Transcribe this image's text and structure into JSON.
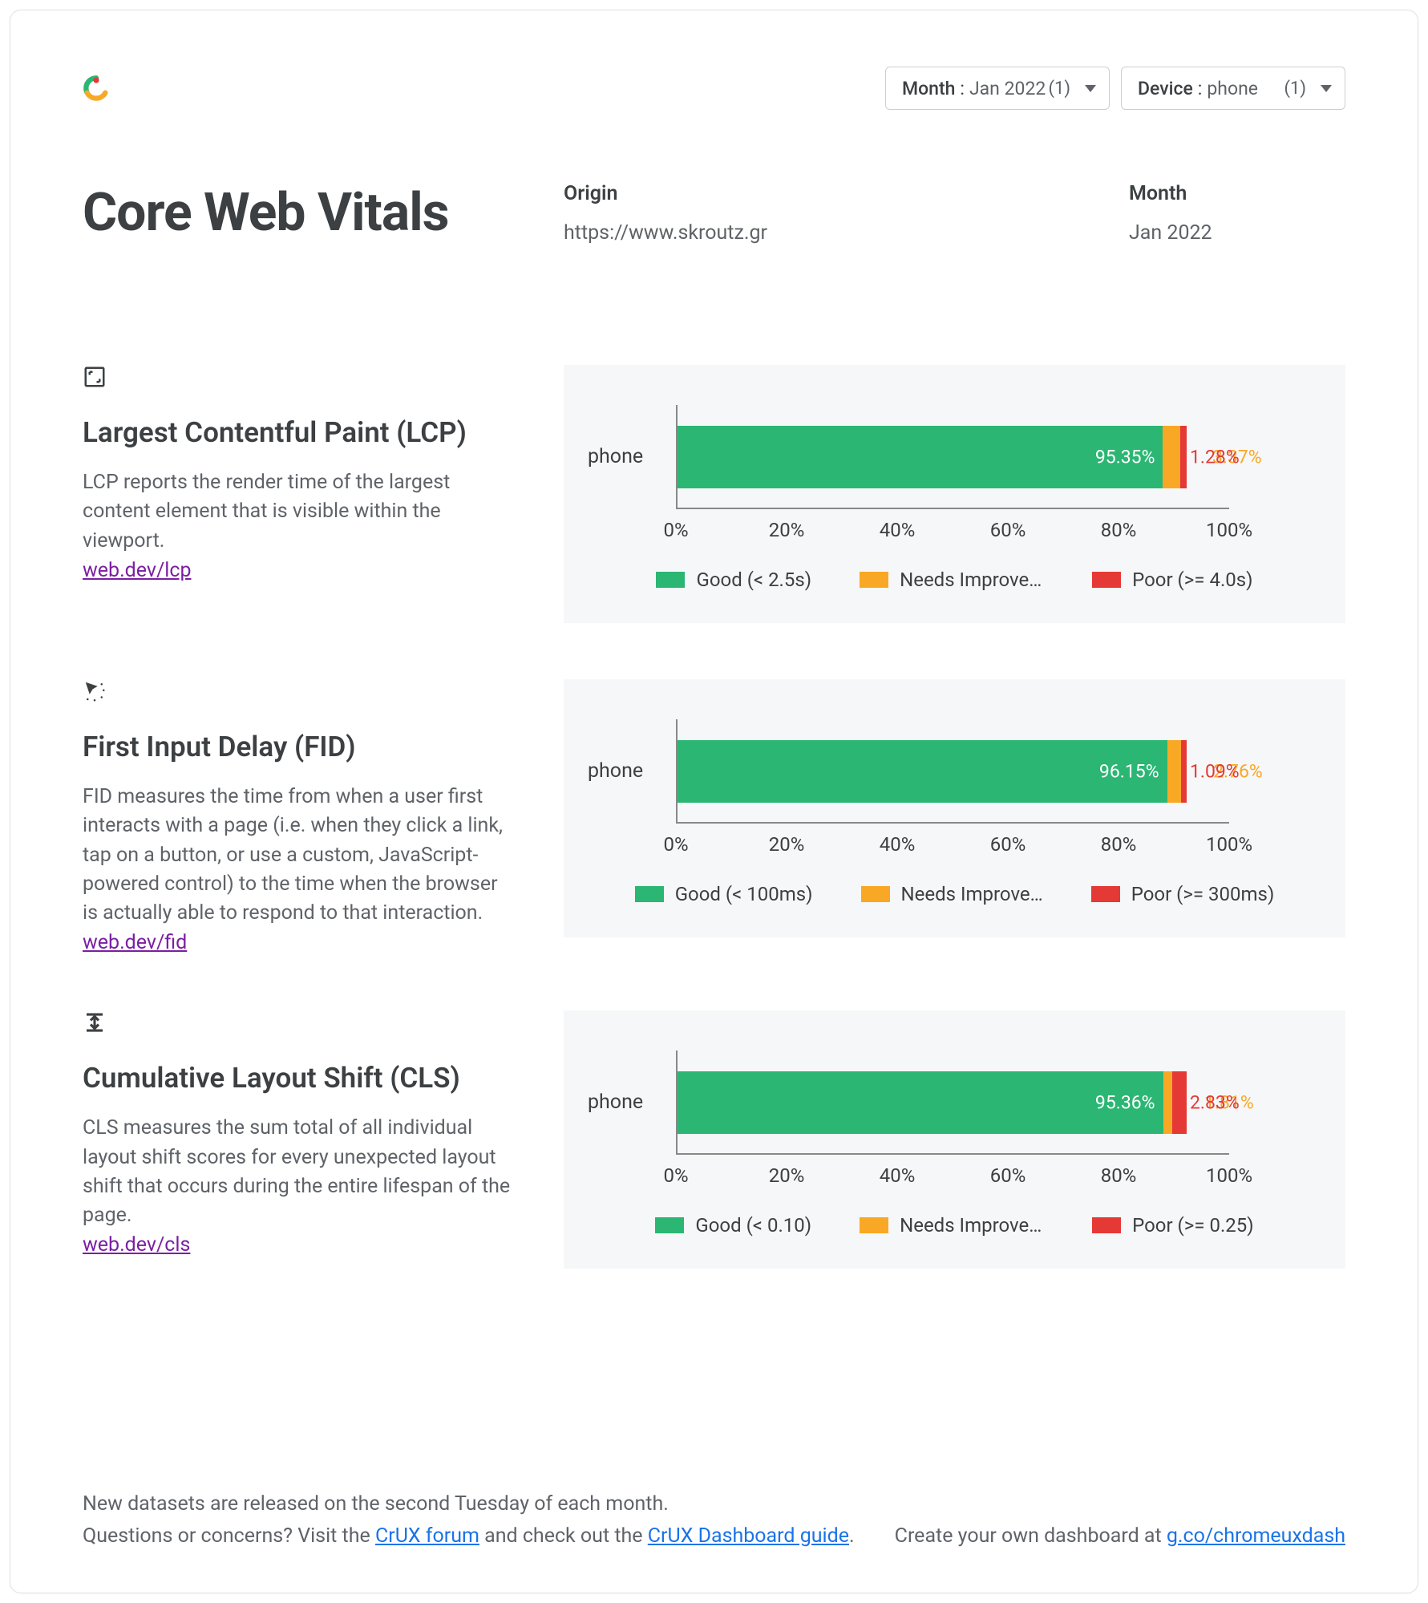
{
  "filters": {
    "month": {
      "label": "Month",
      "value": "Jan 2022",
      "count": "(1)"
    },
    "device": {
      "label": "Device",
      "value": "phone",
      "count": "(1)"
    }
  },
  "title": "Core Web Vitals",
  "meta": {
    "origin_label": "Origin",
    "origin_value": "https://www.skroutz.gr",
    "month_label": "Month",
    "month_value": "Jan 2022"
  },
  "axis_ticks": [
    "0%",
    "20%",
    "40%",
    "60%",
    "80%",
    "100%"
  ],
  "metrics": [
    {
      "id": "lcp",
      "title": "Largest Contentful Paint (LCP)",
      "desc": "LCP reports the render time of the largest content element that is visible within the viewport.",
      "link_text": "web.dev/lcp",
      "category": "phone",
      "good": {
        "pct": 95.35,
        "label": "95.35%"
      },
      "ni": {
        "pct": 3.37,
        "label": "3.37%"
      },
      "poor": {
        "pct": 1.28,
        "label": "1.28%"
      },
      "legend": {
        "good": "Good (< 2.5s)",
        "ni": "Needs Improvement",
        "poor": "Poor (>= 4.0s)"
      }
    },
    {
      "id": "fid",
      "title": "First Input Delay (FID)",
      "desc": "FID measures the time from when a user first interacts with a page (i.e. when they click a link, tap on a button, or use a custom, JavaScript-powered control) to the time when the browser is actually able to respond to that interaction.",
      "link_text": "web.dev/fid",
      "category": "phone",
      "good": {
        "pct": 96.15,
        "label": "96.15%"
      },
      "ni": {
        "pct": 2.76,
        "label": "2.76%"
      },
      "poor": {
        "pct": 1.09,
        "label": "1.09%"
      },
      "legend": {
        "good": "Good (< 100ms)",
        "ni": "Needs Improve…",
        "poor": "Poor (>= 300ms)"
      }
    },
    {
      "id": "cls",
      "title": "Cumulative Layout Shift (CLS)",
      "desc": "CLS measures the sum total of all individual layout shift scores for every unexpected layout shift that occurs during the entire lifespan of the page.",
      "link_text": "web.dev/cls",
      "category": "phone",
      "good": {
        "pct": 95.36,
        "label": "95.36%"
      },
      "ni": {
        "pct": 1.81,
        "label": "1.81%"
      },
      "poor": {
        "pct": 2.83,
        "label": "2.83%"
      },
      "legend": {
        "good": "Good (< 0.10)",
        "ni": "Needs Improvement",
        "poor": "Poor (>= 0.25)"
      }
    }
  ],
  "footer": {
    "line1": "New datasets are released on the second Tuesday of each month.",
    "line2a": "Questions or concerns? Visit the ",
    "link1": "CrUX forum",
    "line2b": " and check out the ",
    "link2": "CrUX Dashboard guide",
    "line2c": ".",
    "cta_a": "Create your own dashboard at ",
    "cta_link": "g.co/chromeuxdash"
  },
  "chart_data": [
    {
      "type": "bar",
      "orientation": "horizontal",
      "stacked": true,
      "title": "Largest Contentful Paint (LCP)",
      "categories": [
        "phone"
      ],
      "series": [
        {
          "name": "Good (< 2.5s)",
          "values": [
            95.35
          ],
          "color": "#2bb673"
        },
        {
          "name": "Needs Improvement",
          "values": [
            3.37
          ],
          "color": "#f9a825"
        },
        {
          "name": "Poor (>= 4.0s)",
          "values": [
            1.28
          ],
          "color": "#e53935"
        }
      ],
      "xlabel": "",
      "ylabel": "",
      "xlim": [
        0,
        100
      ],
      "x_ticks": [
        0,
        20,
        40,
        60,
        80,
        100
      ],
      "unit": "%"
    },
    {
      "type": "bar",
      "orientation": "horizontal",
      "stacked": true,
      "title": "First Input Delay (FID)",
      "categories": [
        "phone"
      ],
      "series": [
        {
          "name": "Good (< 100ms)",
          "values": [
            96.15
          ],
          "color": "#2bb673"
        },
        {
          "name": "Needs Improvement",
          "values": [
            2.76
          ],
          "color": "#f9a825"
        },
        {
          "name": "Poor (>= 300ms)",
          "values": [
            1.09
          ],
          "color": "#e53935"
        }
      ],
      "xlabel": "",
      "ylabel": "",
      "xlim": [
        0,
        100
      ],
      "x_ticks": [
        0,
        20,
        40,
        60,
        80,
        100
      ],
      "unit": "%"
    },
    {
      "type": "bar",
      "orientation": "horizontal",
      "stacked": true,
      "title": "Cumulative Layout Shift (CLS)",
      "categories": [
        "phone"
      ],
      "series": [
        {
          "name": "Good (< 0.10)",
          "values": [
            95.36
          ],
          "color": "#2bb673"
        },
        {
          "name": "Needs Improvement",
          "values": [
            1.81
          ],
          "color": "#f9a825"
        },
        {
          "name": "Poor (>= 0.25)",
          "values": [
            2.83
          ],
          "color": "#e53935"
        }
      ],
      "xlabel": "",
      "ylabel": "",
      "xlim": [
        0,
        100
      ],
      "x_ticks": [
        0,
        20,
        40,
        60,
        80,
        100
      ],
      "unit": "%"
    }
  ]
}
